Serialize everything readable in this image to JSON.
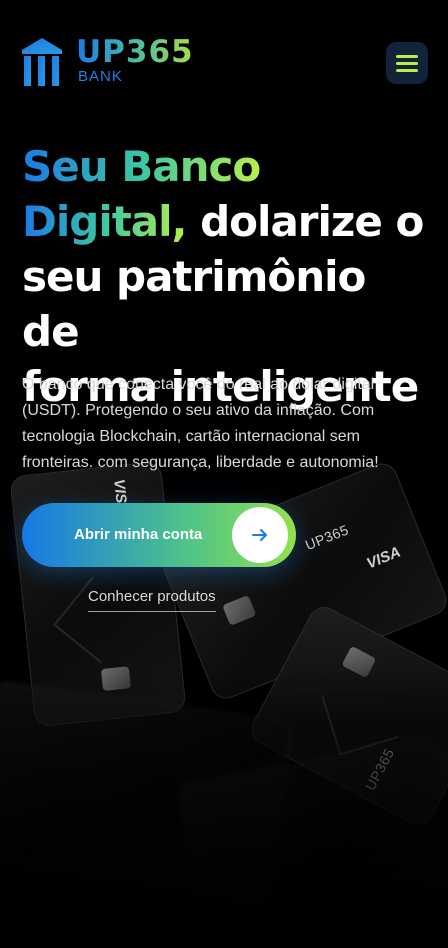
{
  "header": {
    "brand_name": "UP365",
    "brand_sub": "BANK",
    "logo_icon": "bank-building-icon",
    "menu_icon": "hamburger-menu-icon",
    "accent_color": "#b8f04a",
    "brand_blue": "#1a7be8"
  },
  "hero": {
    "title_highlight_1": "Seu Banco",
    "title_highlight_2": "Digital,",
    "title_rest_1": " dolarize o",
    "title_rest_2": "seu patrimônio de",
    "title_rest_3": "forma inteligente",
    "description": "O banco que conecta você do real ao dólar digital (USDT). Protegendo o seu ativo da inflação. Com tecnologia Blockchain, cartão internacional sem fronteiras. com segurança, liberdade e autonomia!",
    "cta_label": "Abrir minha conta",
    "cta_icon": "arrow-right-icon",
    "secondary_link": "Conhecer produtos"
  },
  "cards": {
    "brand": "UP365",
    "network": "VISA"
  }
}
